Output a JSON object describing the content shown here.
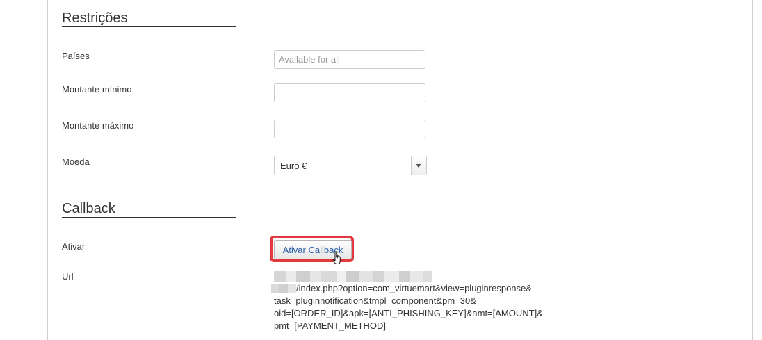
{
  "restrictions": {
    "title": "Restrições",
    "countries_label": "Países",
    "countries_placeholder": "Available for all",
    "min_amount_label": "Montante mínimo",
    "min_amount_value": "",
    "max_amount_label": "Montante máximo",
    "max_amount_value": "",
    "currency_label": "Moeda",
    "currency_selected": "Euro €"
  },
  "callback": {
    "title": "Callback",
    "activate_label": "Ativar",
    "activate_button": "Ativar Callback",
    "url_label": "Url",
    "url_value": "/index.php?option=com_virtuemart&view=pluginresponse&\ntask=pluginnotification&tmpl=component&pm=30&\noid=[ORDER_ID]&apk=[ANTI_PHISHING_KEY]&amt=[AMOUNT]&\npmt=[PAYMENT_METHOD]"
  },
  "colors": {
    "highlight": "#e03a3e",
    "button_text": "#2a5ea8"
  },
  "icons": {
    "currency_dropdown": "chevron-down-icon",
    "pointer": "hand-cursor-icon"
  }
}
